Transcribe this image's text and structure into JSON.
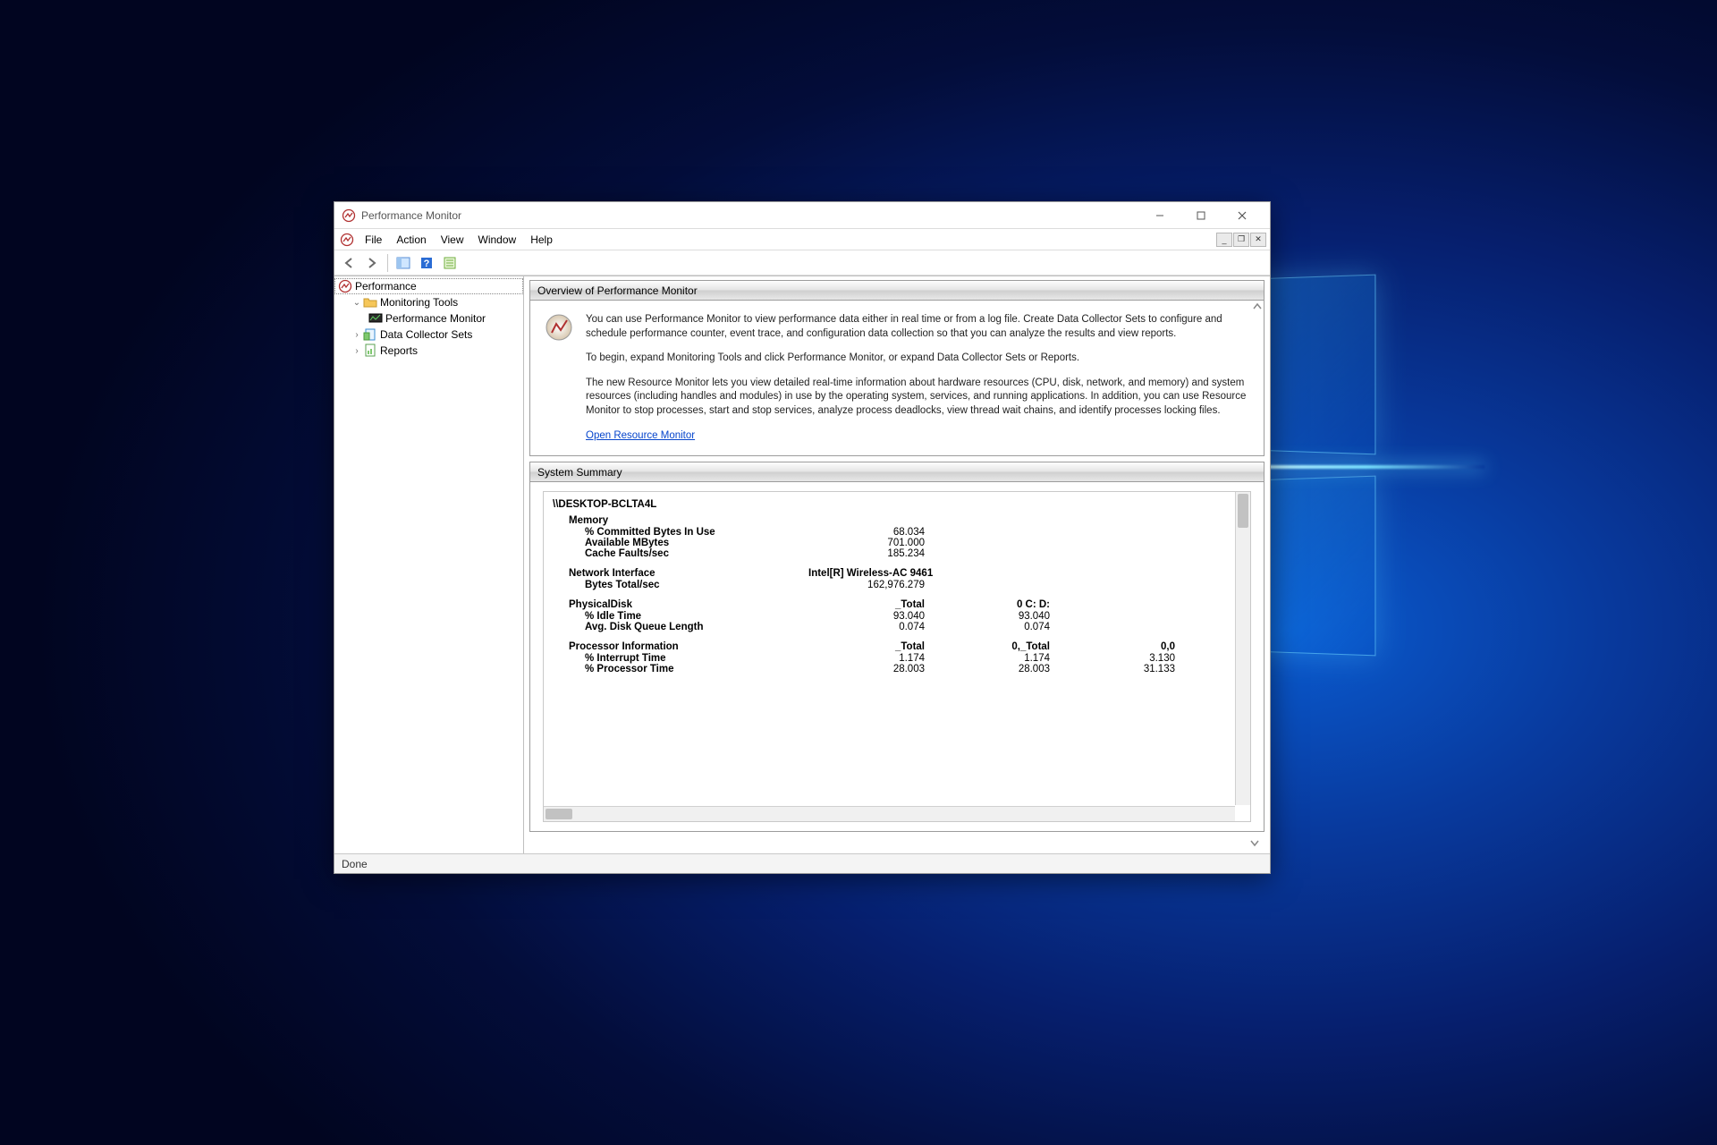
{
  "window": {
    "title": "Performance Monitor"
  },
  "menu": {
    "file": "File",
    "action": "Action",
    "view": "View",
    "window": "Window",
    "help": "Help"
  },
  "tree": {
    "root": "Performance",
    "monitoring_tools": "Monitoring Tools",
    "performance_monitor": "Performance Monitor",
    "data_collector_sets": "Data Collector Sets",
    "reports": "Reports"
  },
  "overview": {
    "title": "Overview of Performance Monitor",
    "p1": "You can use Performance Monitor to view performance data either in real time or from a log file. Create Data Collector Sets to configure and schedule performance counter, event trace, and configuration data collection so that you can analyze the results and view reports.",
    "p2": "To begin, expand Monitoring Tools and click Performance Monitor, or expand Data Collector Sets or Reports.",
    "p3": "The new Resource Monitor lets you view detailed real-time information about hardware resources (CPU, disk, network, and memory) and system resources (including handles and modules) in use by the operating system, services, and running applications. In addition, you can use Resource Monitor to stop processes, start and stop services, analyze process deadlocks, view thread wait chains, and identify processes locking files.",
    "link": "Open Resource Monitor"
  },
  "summary": {
    "title": "System Summary",
    "host": "\\\\DESKTOP-BCLTA4L",
    "memory": {
      "label": "Memory",
      "committed_label": "% Committed Bytes In Use",
      "committed_val": "68.034",
      "available_label": "Available MBytes",
      "available_val": "701.000",
      "cache_label": "Cache Faults/sec",
      "cache_val": "185.234"
    },
    "net": {
      "label": "Network Interface",
      "iface": "Intel[R] Wireless-AC 9461",
      "bytes_label": "Bytes Total/sec",
      "bytes_val": "162,976.279"
    },
    "disk": {
      "label": "PhysicalDisk",
      "col1": "_Total",
      "col2": "0 C: D:",
      "idle_label": "% Idle Time",
      "idle_v1": "93.040",
      "idle_v2": "93.040",
      "queue_label": "Avg. Disk Queue Length",
      "queue_v1": "0.074",
      "queue_v2": "0.074"
    },
    "proc": {
      "label": "Processor Information",
      "col1": "_Total",
      "col2": "0,_Total",
      "col3": "0,0",
      "int_label": "% Interrupt Time",
      "int_v1": "1.174",
      "int_v2": "1.174",
      "int_v3": "3.130",
      "pt_label": "% Processor Time",
      "pt_v1": "28.003",
      "pt_v2": "28.003",
      "pt_v3": "31.133"
    }
  },
  "status": {
    "text": "Done"
  }
}
